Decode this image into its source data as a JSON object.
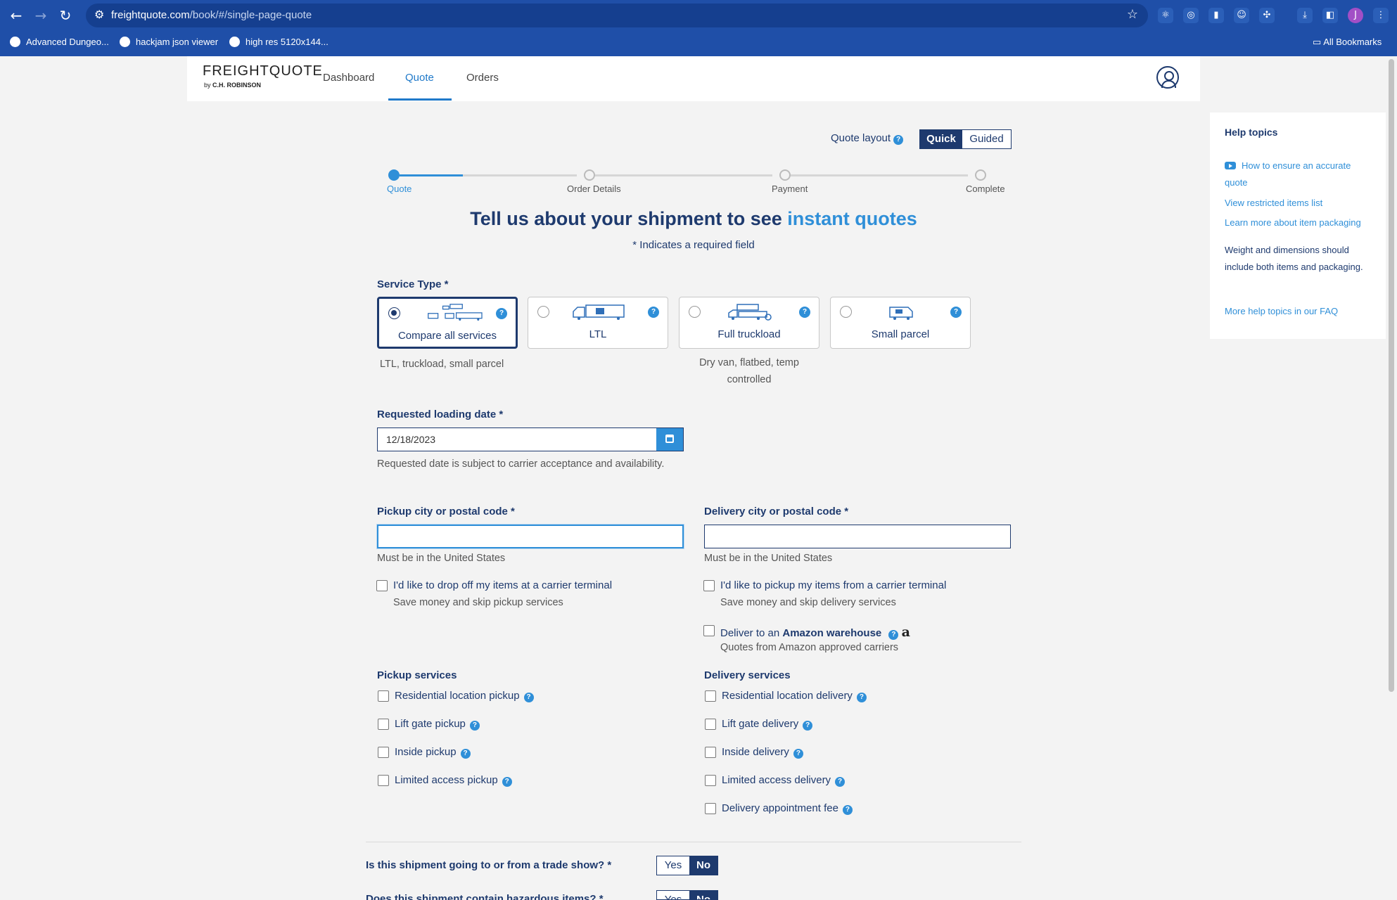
{
  "browser": {
    "url_host": "freightquote.com",
    "url_path": "/book/#/single-page-quote",
    "bookmarks": [
      "Advanced Dungeo...",
      "hackjam json viewer",
      "high res 5120x144..."
    ],
    "all_bookmarks": "All Bookmarks",
    "profile_initial": "J"
  },
  "header": {
    "logo_main": "FREIGHTQUOTE",
    "logo_by": "by",
    "logo_sub": "C.H. ROBINSON",
    "tabs": [
      "Dashboard",
      "Quote",
      "Orders"
    ],
    "active_tab": "Quote"
  },
  "layout_toggle": {
    "label": "Quote layout",
    "quick": "Quick",
    "guided": "Guided",
    "selected": "Quick"
  },
  "stepper": {
    "steps": [
      "Quote",
      "Order Details",
      "Payment",
      "Complete"
    ],
    "current": "Quote"
  },
  "headline": {
    "text": "Tell us about your shipment to see",
    "accent": "instant quotes"
  },
  "required_note": "* Indicates a required field",
  "service_type": {
    "label": "Service Type *",
    "options": [
      {
        "name": "Compare all services",
        "subtitle": "LTL, truckload, small parcel",
        "selected": true
      },
      {
        "name": "LTL",
        "subtitle": "",
        "selected": false
      },
      {
        "name": "Full truckload",
        "subtitle": "Dry van, flatbed, temp controlled",
        "selected": false
      },
      {
        "name": "Small parcel",
        "subtitle": "",
        "selected": false
      }
    ]
  },
  "loading_date": {
    "label": "Requested loading date *",
    "value": "12/18/2023",
    "hint": "Requested date is subject to carrier acceptance and availability."
  },
  "pickup": {
    "label": "Pickup city or postal code *",
    "value": "",
    "hint": "Must be in the United States",
    "terminal_label": "I'd like to drop off my items at a carrier terminal",
    "terminal_sub": "Save money and skip pickup services",
    "services_label": "Pickup services",
    "services": [
      "Residential location pickup",
      "Lift gate pickup",
      "Inside pickup",
      "Limited access pickup"
    ]
  },
  "delivery": {
    "label": "Delivery city or postal code *",
    "value": "",
    "hint": "Must be in the United States",
    "terminal_label": "I'd like to pickup my items from a carrier terminal",
    "terminal_sub": "Save money and skip delivery services",
    "amazon_prefix": "Deliver to an",
    "amazon_bold": "Amazon warehouse",
    "amazon_sub": "Quotes from Amazon approved carriers",
    "services_label": "Delivery services",
    "services": [
      "Residential location delivery",
      "Lift gate delivery",
      "Inside delivery",
      "Limited access delivery",
      "Delivery appointment fee"
    ]
  },
  "questions": [
    {
      "text": "Is this shipment going to or from a trade show? *",
      "yes": "Yes",
      "no": "No",
      "selected": "No"
    },
    {
      "text": "Does this shipment contain hazardous items? *",
      "yes": "Yes",
      "no": "No",
      "selected": "No"
    }
  ],
  "help": {
    "title": "Help topics",
    "links": [
      "How to ensure an accurate quote",
      "View restricted items list",
      "Learn more about item packaging"
    ],
    "note": "Weight and dimensions should include both items and packaging.",
    "faq": "More help topics in our FAQ"
  },
  "colors": {
    "brand_navy": "#1e3a6e",
    "accent_blue": "#2f8fd8",
    "chrome_blue": "#1f4fa8"
  }
}
